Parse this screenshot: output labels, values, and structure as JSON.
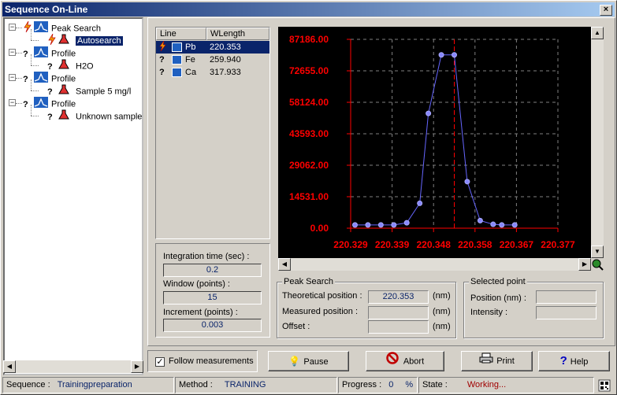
{
  "window": {
    "title": "Sequence On-Line",
    "close_label": "×"
  },
  "tree": {
    "nodes": [
      {
        "label": "Peak Search",
        "status": "running",
        "icon": "peak-search-icon"
      },
      {
        "label": "Autosearch",
        "status": "running",
        "icon": "flask-icon",
        "selected": true
      },
      {
        "label": "Profile",
        "status": "?",
        "icon": "profile-icon"
      },
      {
        "label": "H2O",
        "status": "?",
        "icon": "flask-icon"
      },
      {
        "label": "Profile",
        "status": "?",
        "icon": "profile-icon"
      },
      {
        "label": "Sample 5 mg/l",
        "status": "?",
        "icon": "flask-icon"
      },
      {
        "label": "Profile",
        "status": "?",
        "icon": "profile-icon"
      },
      {
        "label": "Unknown sample",
        "status": "?",
        "icon": "flask-icon"
      }
    ],
    "status_question": "?"
  },
  "lines": {
    "header_line": "Line",
    "header_wlength": "WLength",
    "rows": [
      {
        "element": "Pb",
        "wlength": "220.353",
        "selected": true
      },
      {
        "element": "Fe",
        "wlength": "259.940"
      },
      {
        "element": "Ca",
        "wlength": "317.933"
      }
    ]
  },
  "params": {
    "integration_label": "Integration time (sec) :",
    "integration_value": "0.2",
    "window_label": "Window (points) :",
    "window_value": "15",
    "increment_label": "Increment (points) :",
    "increment_value": "0.003"
  },
  "peak_search": {
    "title": "Peak Search",
    "theoretical_label": "Theoretical  position :",
    "theoretical_value": "220.353",
    "measured_label": "Measured position :",
    "measured_value": "",
    "offset_label": "Offset :",
    "offset_value": "",
    "unit": "(nm)"
  },
  "selected_point": {
    "title": "Selected point",
    "position_label": "Position (nm) :",
    "position_value": "",
    "intensity_label": "Intensity :",
    "intensity_value": ""
  },
  "buttons": {
    "follow_label": "Follow measurements",
    "follow_checked": true,
    "pause_label": "Pause",
    "abort_label": "Abort",
    "print_label": "Print",
    "help_label": "Help"
  },
  "status": {
    "sequence_label": "Sequence :",
    "sequence_value": "Trainingpreparation",
    "method_label": "Method :",
    "method_value": "TRAINING",
    "progress_label": "Progress :",
    "progress_value": "0",
    "progress_unit": "%",
    "state_label": "State :",
    "state_value": "Working..."
  },
  "chart_data": {
    "type": "line",
    "y_tick_labels": [
      "87186.00",
      "72655.00",
      "58124.00",
      "43593.00",
      "29062.00",
      "14531.00",
      "0.00"
    ],
    "x_tick_labels": [
      "220.329",
      "220.339",
      "220.348",
      "220.358",
      "220.367",
      "220.377"
    ],
    "ylim": [
      0,
      87186
    ],
    "xlim": [
      220.329,
      220.377
    ],
    "grid": true,
    "marker_line_x": 220.353,
    "x": [
      220.33,
      220.333,
      220.336,
      220.339,
      220.342,
      220.345,
      220.347,
      220.35,
      220.353,
      220.356,
      220.359,
      220.362,
      220.364,
      220.367
    ],
    "y": [
      1500,
      1500,
      1500,
      1500,
      2500,
      11500,
      53000,
      80000,
      80000,
      21500,
      3500,
      1800,
      1500,
      1500
    ],
    "colors": {
      "background": "#000000",
      "axis": "#ff0000",
      "grid": "#808080",
      "series": "#6666ff",
      "marker_line": "#ff0000"
    }
  }
}
